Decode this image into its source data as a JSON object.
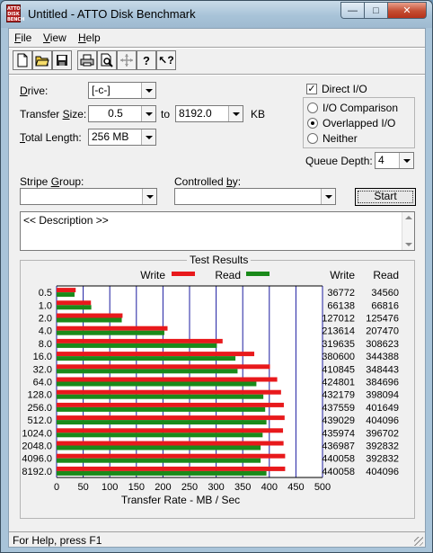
{
  "window": {
    "title": "Untitled - ATTO Disk Benchmark",
    "icon_text": "ATTO DISK BENCH"
  },
  "menu": [
    {
      "label": "File",
      "key": "F",
      "rest": "ile"
    },
    {
      "label": "View",
      "key": "V",
      "rest": "iew"
    },
    {
      "label": "Help",
      "key": "H",
      "rest": "elp"
    }
  ],
  "toolbar": [
    "new-file-icon",
    "open-folder-icon",
    "save-icon",
    "print-icon",
    "print-preview-icon",
    "move-icon",
    "help-icon",
    "context-help-icon"
  ],
  "form": {
    "drive_label": "Drive:",
    "drive_value": "[-c-]",
    "transfer_size_label": "Transfer Size:",
    "transfer_from": "0.5",
    "to_label": "to",
    "transfer_to": "8192.0",
    "kb_label": "KB",
    "total_length_label": "Total Length:",
    "total_length_value": "256 MB",
    "direct_io_label": "Direct I/O",
    "direct_io_checked": true,
    "radio_io_comparison": "I/O Comparison",
    "radio_overlapped": "Overlapped I/O",
    "radio_neither": "Neither",
    "queue_depth_label": "Queue Depth:",
    "queue_depth_value": "4",
    "stripe_group_label": "Stripe Group:",
    "stripe_group_value": "",
    "controlled_by_label": "Controlled by:",
    "controlled_by_value": "",
    "start_label": "Start",
    "description": "<< Description >>"
  },
  "results": {
    "title": "Test Results",
    "write_legend": "Write",
    "read_legend": "Read",
    "write_col": "Write",
    "read_col": "Read",
    "x_axis_label": "Transfer Rate - MB / Sec"
  },
  "colors": {
    "write": "#e8191c",
    "read": "#1a8a1a",
    "grid": "#1c1ca0"
  },
  "chart_data": {
    "type": "bar",
    "orientation": "horizontal",
    "categories": [
      "0.5",
      "1.0",
      "2.0",
      "4.0",
      "8.0",
      "16.0",
      "32.0",
      "64.0",
      "128.0",
      "256.0",
      "512.0",
      "1024.0",
      "2048.0",
      "4096.0",
      "8192.0"
    ],
    "series": [
      {
        "name": "Write",
        "values": [
          36772,
          66138,
          127012,
          213614,
          319635,
          380600,
          410845,
          424801,
          432179,
          437559,
          439029,
          435974,
          436987,
          440058,
          440058
        ]
      },
      {
        "name": "Read",
        "values": [
          34560,
          66816,
          125476,
          207470,
          308623,
          344388,
          348443,
          384696,
          398094,
          401649,
          404096,
          396702,
          392832,
          392832,
          404096
        ]
      }
    ],
    "write_text": [
      "36772",
      "66138",
      "127012",
      "213614",
      "319635",
      "380600",
      "410845",
      "424801",
      "432179",
      "437559",
      "439029",
      "435974",
      "436987",
      "440058",
      "440058"
    ],
    "read_text": [
      "34560",
      "66816",
      "125476",
      "207470",
      "308623",
      "344388",
      "348443",
      "384696",
      "398094",
      "401649",
      "404096",
      "396702",
      "392832",
      "392832",
      "404096"
    ],
    "xticks": [
      "0",
      "50",
      "100",
      "150",
      "200",
      "250",
      "300",
      "350",
      "400",
      "450",
      "500"
    ],
    "xlim": [
      0,
      500
    ],
    "xlabel": "Transfer Rate - MB / Sec",
    "grid": true,
    "legend": "top"
  },
  "status": {
    "text": "For Help, press F1"
  }
}
